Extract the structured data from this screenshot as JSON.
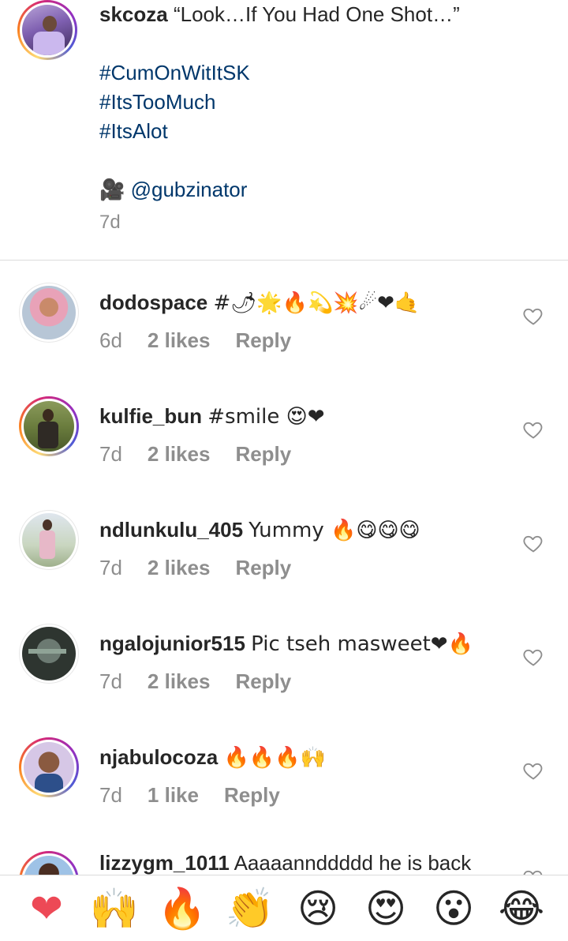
{
  "caption": {
    "username": "skcoza",
    "quote": "“Look…If You Had One Shot…”",
    "hashtags": [
      "#CumOnWitItSK",
      "#ItsTooMuch",
      "#ItsAlot"
    ],
    "credit_emoji": "🎥",
    "credit": "@gubzinator",
    "time": "7d"
  },
  "comments": [
    {
      "username": "dodospace",
      "text": "#🌶🌟🔥💫💥☄❤🤙",
      "time": "6d",
      "likes": "2 likes",
      "reply": "Reply"
    },
    {
      "username": "kulfie_bun",
      "text": "#smile 😍❤",
      "time": "7d",
      "likes": "2 likes",
      "reply": "Reply"
    },
    {
      "username": "ndlunkulu_405",
      "text": "Yummy 🔥😋😋😋",
      "time": "7d",
      "likes": "2 likes",
      "reply": "Reply"
    },
    {
      "username": "ngalojunior515",
      "text": "Pic tseh masweet❤🔥",
      "time": "7d",
      "likes": "2 likes",
      "reply": "Reply"
    },
    {
      "username": "njabulocoza",
      "text": "🔥🔥🔥🙌",
      "time": "7d",
      "likes": "1 like",
      "reply": "Reply"
    },
    {
      "username": "lizzygm_1011",
      "text": "Aaaaannddddd he is back",
      "time": "",
      "likes": "",
      "reply": ""
    }
  ],
  "reactions": [
    "❤",
    "🙌",
    "🔥",
    "👏",
    "😢",
    "😍",
    "😮",
    "😂"
  ],
  "colors": {
    "accent_heart": "#ed4956",
    "hashtag": "#00376b",
    "muted": "#8e8e8e"
  }
}
